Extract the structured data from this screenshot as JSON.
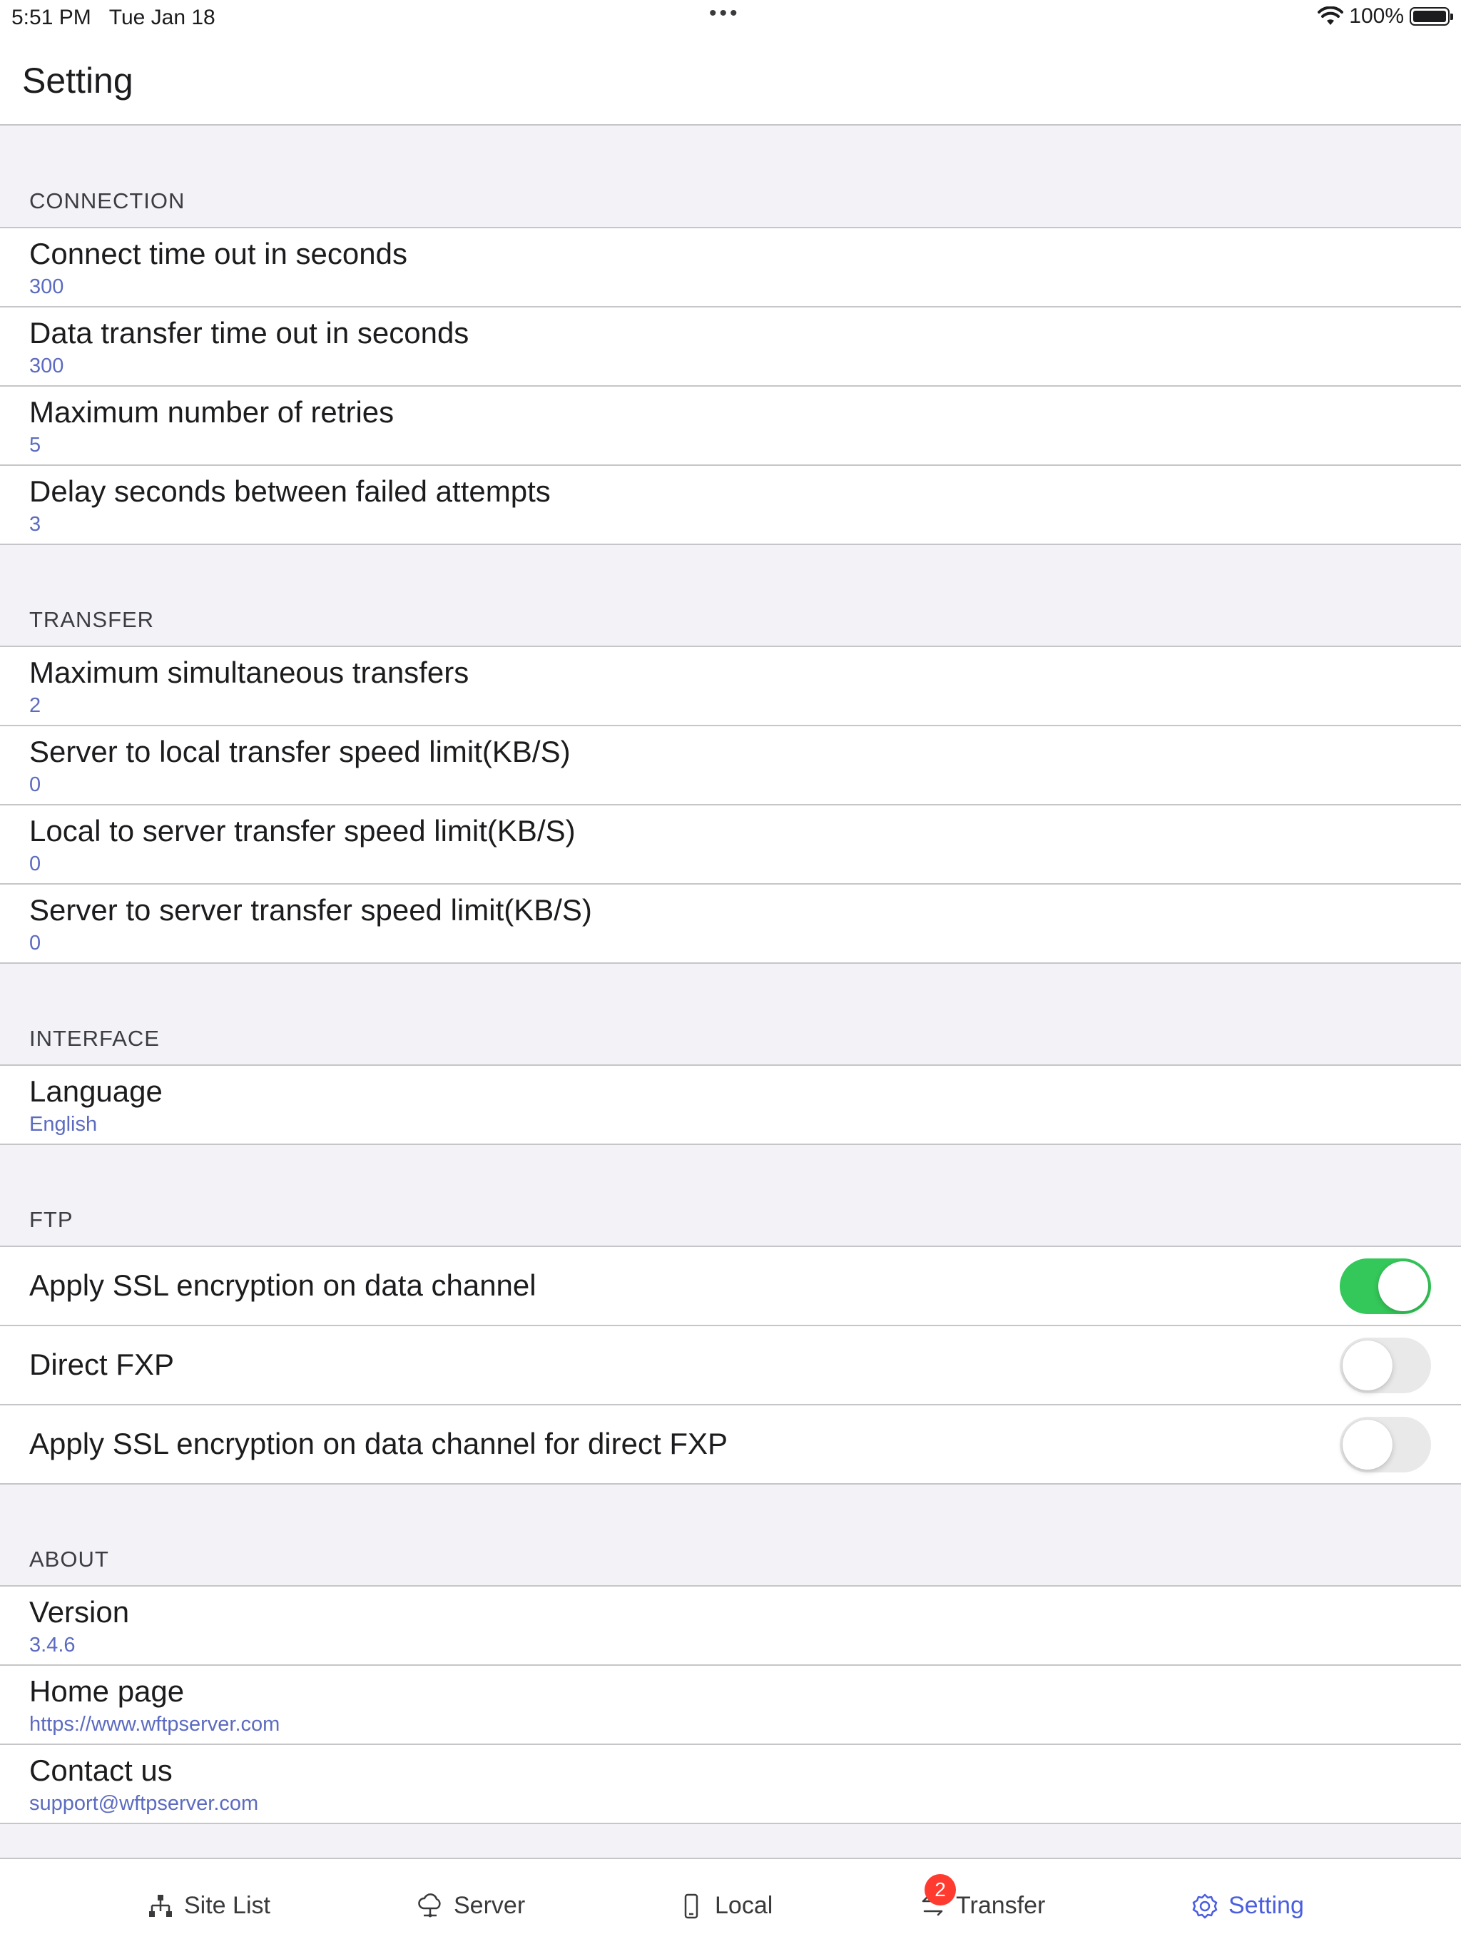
{
  "status_bar": {
    "time": "5:51 PM",
    "date": "Tue Jan 18",
    "multitask": "•••",
    "battery": "100%",
    "icons": [
      "wifi-icon",
      "battery-icon"
    ]
  },
  "nav": {
    "title": "Setting"
  },
  "sections": {
    "connection": {
      "header": "CONNECTION",
      "rows": [
        {
          "label": "Connect time out in seconds",
          "value": "300"
        },
        {
          "label": "Data transfer time out in seconds",
          "value": "300"
        },
        {
          "label": "Maximum number of retries",
          "value": "5"
        },
        {
          "label": "Delay seconds between failed attempts",
          "value": "3"
        }
      ]
    },
    "transfer": {
      "header": "TRANSFER",
      "rows": [
        {
          "label": "Maximum simultaneous transfers",
          "value": "2"
        },
        {
          "label": "Server to local transfer speed limit(KB/S)",
          "value": "0"
        },
        {
          "label": "Local to server transfer speed limit(KB/S)",
          "value": "0"
        },
        {
          "label": "Server to server transfer speed limit(KB/S)",
          "value": "0"
        }
      ]
    },
    "interface": {
      "header": "INTERFACE",
      "rows": [
        {
          "label": "Language",
          "value": "English"
        }
      ]
    },
    "ftp": {
      "header": "FTP",
      "rows": [
        {
          "label": "Apply SSL encryption on data channel",
          "on": true
        },
        {
          "label": "Direct FXP",
          "on": false
        },
        {
          "label": "Apply SSL encryption on data channel for direct FXP",
          "on": false
        }
      ]
    },
    "about": {
      "header": "ABOUT",
      "rows": [
        {
          "label": "Version",
          "value": "3.4.6"
        },
        {
          "label": "Home page",
          "value": "https://www.wftpserver.com"
        },
        {
          "label": "Contact us",
          "value": "support@wftpserver.com"
        }
      ]
    }
  },
  "tabs": {
    "site_list": {
      "label": "Site List",
      "icon": "sitemap-icon"
    },
    "server": {
      "label": "Server",
      "icon": "cloud-server-icon"
    },
    "local": {
      "label": "Local",
      "icon": "phone-icon"
    },
    "transfer": {
      "label": "Transfer",
      "icon": "transfer-arrows-icon",
      "badge": "2"
    },
    "setting": {
      "label": "Setting",
      "icon": "gear-icon",
      "active": true
    }
  },
  "colors": {
    "accent": "#4a5ee0",
    "value_text": "#5c6bc0",
    "toggle_on": "#34c759",
    "toggle_off": "#e9e9ea",
    "badge": "#ff3b30"
  }
}
